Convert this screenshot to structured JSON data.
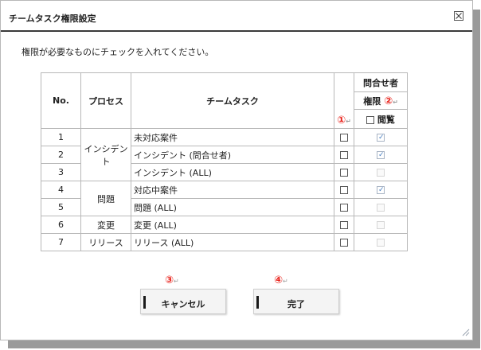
{
  "dialog": {
    "title": "チームタスク権限設定",
    "instruction": "権限が必要なものにチェックを入れてください。"
  },
  "table": {
    "headers": {
      "no": "No.",
      "process": "プロセス",
      "task": "チームタスク",
      "group": "問合せ者",
      "authority": "権限",
      "view": "閲覧"
    },
    "markers": {
      "select_all": "①",
      "authority": "②"
    },
    "processes": [
      {
        "label": "インシデント",
        "rows": 3
      },
      {
        "label": "問題",
        "rows": 2
      },
      {
        "label": "変更",
        "rows": 1
      },
      {
        "label": "リリース",
        "rows": 1
      }
    ],
    "rows": [
      {
        "no": "1",
        "task": "未対応案件",
        "selected": false,
        "view": "checked"
      },
      {
        "no": "2",
        "task": "インシデント (問合せ者)",
        "selected": false,
        "view": "checked"
      },
      {
        "no": "3",
        "task": "インシデント (ALL)",
        "selected": false,
        "view": "disabled"
      },
      {
        "no": "4",
        "task": "対応中案件",
        "selected": false,
        "view": "checked"
      },
      {
        "no": "5",
        "task": "問題 (ALL)",
        "selected": false,
        "view": "disabled"
      },
      {
        "no": "6",
        "task": "変更 (ALL)",
        "selected": false,
        "view": "disabled"
      },
      {
        "no": "7",
        "task": "リリース (ALL)",
        "selected": false,
        "view": "disabled"
      }
    ]
  },
  "buttons": {
    "cancel": {
      "label": "キャンセル",
      "marker": "③"
    },
    "done": {
      "label": "完了",
      "marker": "④"
    }
  },
  "colors": {
    "marker": "#e8211a",
    "check": "#4a7fc1",
    "title_rule": "#3a3a3a"
  }
}
